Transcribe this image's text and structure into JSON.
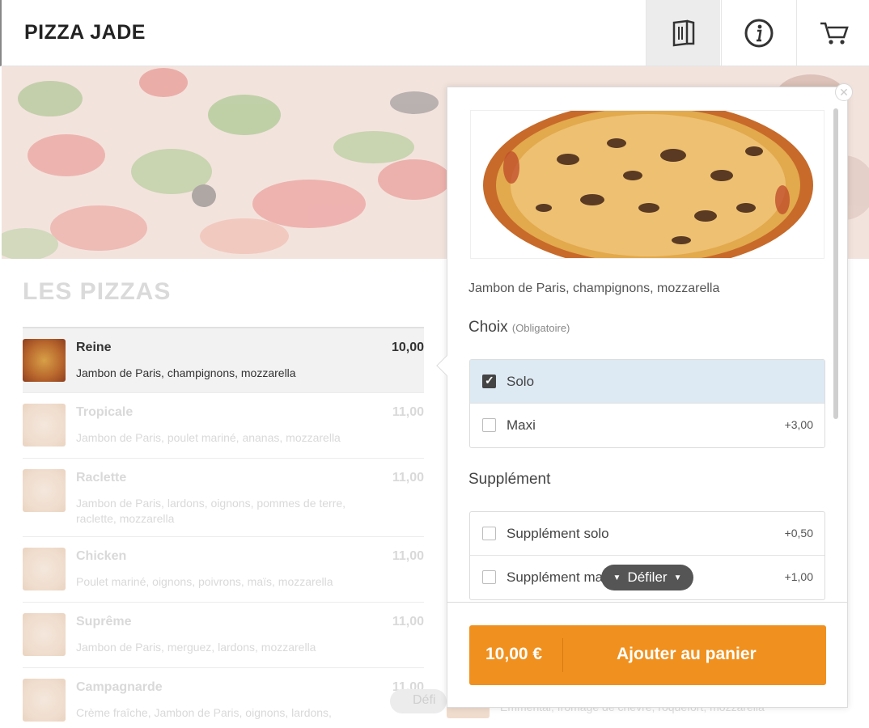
{
  "header": {
    "brand": "PIZZA JADE",
    "icons": [
      "menu-book-icon",
      "info-icon",
      "cart-icon"
    ]
  },
  "section": {
    "title": "LES PIZZAS"
  },
  "menu_items": [
    {
      "name": "Reine",
      "desc": "Jambon de Paris, champignons, mozzarella",
      "price": "10,00"
    },
    {
      "name": "Tropicale",
      "desc": "Jambon de Paris, poulet mariné, ananas, mozzarella",
      "price": "11,00"
    },
    {
      "name": "Raclette",
      "desc": "Jambon de Paris, lardons, oignons, pommes de terre, raclette, mozzarella",
      "price": "11,00"
    },
    {
      "name": "Chicken",
      "desc": "Poulet mariné, oignons, poivrons, maïs, mozzarella",
      "price": "11,00"
    },
    {
      "name": "Suprême",
      "desc": "Jambon de Paris, merguez, lardons, mozzarella",
      "price": "11,00"
    },
    {
      "name": "Campagnarde",
      "desc": "Crème fraîche, Jambon de Paris, oignons, lardons,",
      "price": "11,00"
    }
  ],
  "background_scroll": {
    "label": "Défi"
  },
  "background_strip": {
    "text": "Emmental, fromage de chèvre, roquefort, mozzarella"
  },
  "modal": {
    "description": "Jambon de Paris, champignons, mozzarella",
    "choice_title": "Choix",
    "choice_note": "(Obligatoire)",
    "choices": [
      {
        "label": "Solo",
        "price": "",
        "checked": true
      },
      {
        "label": "Maxi",
        "price": "+3,00",
        "checked": false
      }
    ],
    "supp_title": "Supplément",
    "supplements": [
      {
        "label": "Supplément solo",
        "price": "+0,50"
      },
      {
        "label": "Supplément maxi",
        "price": "+1,00"
      }
    ],
    "scroll_label": "Défiler",
    "footer": {
      "price": "10,00 €",
      "add_label": "Ajouter au panier"
    }
  },
  "colors": {
    "accent": "#f0901e",
    "selected": "#dde9f3",
    "scroll_pill": "#555555"
  }
}
